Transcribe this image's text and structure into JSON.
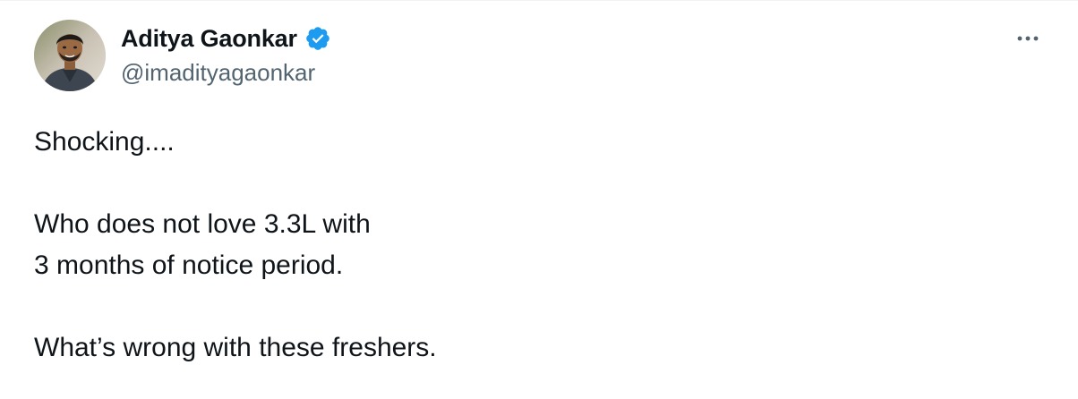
{
  "author": {
    "display_name": "Aditya Gaonkar",
    "handle": "@imadityagaonkar",
    "verified": true,
    "avatar_icon": "user-avatar-photo"
  },
  "menu": {
    "more_icon": "more-horizontal-icon"
  },
  "tweet": {
    "lines": [
      "Shocking....",
      "Who does not love 3.3L with",
      "3 months of notice period.",
      "What’s wrong with these freshers."
    ]
  },
  "colors": {
    "text_primary": "#0f1419",
    "text_secondary": "#536471",
    "verified_blue": "#1d9bf0",
    "background": "#ffffff"
  }
}
